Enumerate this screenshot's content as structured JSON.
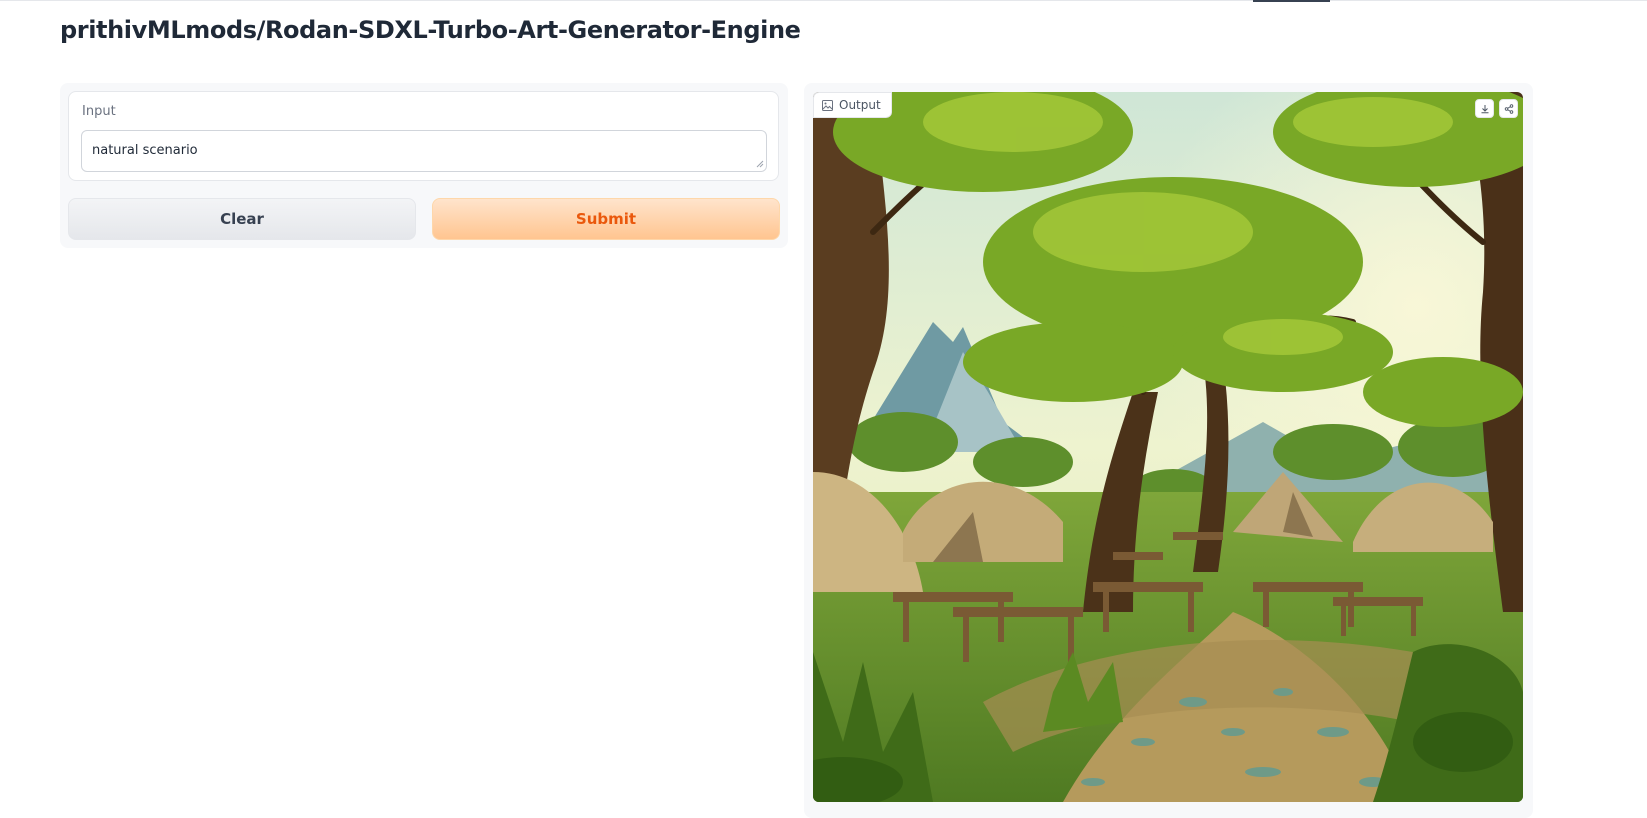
{
  "header": {
    "title": "prithivMLmods/Rodan-SDXL-Turbo-Art-Generator-Engine"
  },
  "input_panel": {
    "label": "Input",
    "value": "natural scenario"
  },
  "buttons": {
    "clear_label": "Clear",
    "submit_label": "Submit"
  },
  "output_panel": {
    "label": "Output",
    "label_icon": "image-icon",
    "actions": [
      "download-icon",
      "share-icon"
    ],
    "image_alt": "Generated cartoon campsite with tents and picnic tables under tall green trees, mountains in the background"
  },
  "colors": {
    "submit_text": "#ea580c",
    "submit_bg": "#ffd3ab",
    "clear_bg": "#eceef1"
  }
}
